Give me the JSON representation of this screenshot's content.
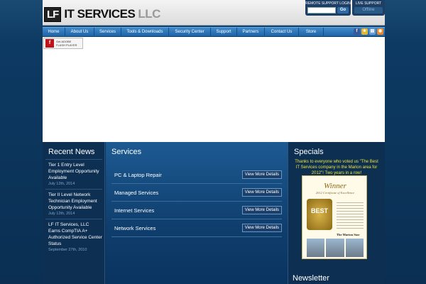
{
  "header": {
    "logo_mark": "LF",
    "logo_text": "IT SERVICES",
    "logo_suffix": "LLC",
    "remote_label": "REMOTE SUPPORT LOGIN",
    "remote_go": "Go",
    "live_label": "LIVE SUPPORT",
    "live_status": "Offline"
  },
  "nav": {
    "items": [
      "Home",
      "About Us",
      "Services",
      "Tools & Downloads",
      "Security Center",
      "Support",
      "Partners",
      "Contact Us",
      "Store"
    ]
  },
  "social": {
    "icons": [
      "facebook-icon",
      "star-icon",
      "folder-icon",
      "rss-icon"
    ],
    "colors": [
      "#3b5998",
      "#e5b52a",
      "#6a9bd1",
      "#f08a24"
    ]
  },
  "flash": {
    "icon": "f",
    "line1": "Get ADOBE",
    "line2": "FLASH PLAYER"
  },
  "news": {
    "title": "Recent News",
    "items": [
      {
        "title": "Tier 1 Entry Level Employment Opportunity Available",
        "date": "July 12th, 2014"
      },
      {
        "title": "Tier II Level Network Technician Employment Opportunity Available",
        "date": "July 12th, 2014"
      },
      {
        "title": "LF IT Services, LLC Earns CompTIA A+ Authorized Service Center Status",
        "date": "September 27th, 2010"
      }
    ]
  },
  "services": {
    "title": "Services",
    "button_label": "View More Details",
    "items": [
      "PC & Laptop Repair",
      "Managed Services",
      "Internet Services",
      "Network Services"
    ]
  },
  "specials": {
    "title": "Specials",
    "text": "Thanks to everyone who voted us \"The Best IT Services company in the Marion area for 2012\"! Two years in a row!",
    "cert_winner": "Winner",
    "cert_sub": "2012 Certificate of Excellence",
    "cert_best": "BEST",
    "cert_paper": "The Marion Star"
  },
  "newsletter": {
    "title": "Newsletter"
  }
}
